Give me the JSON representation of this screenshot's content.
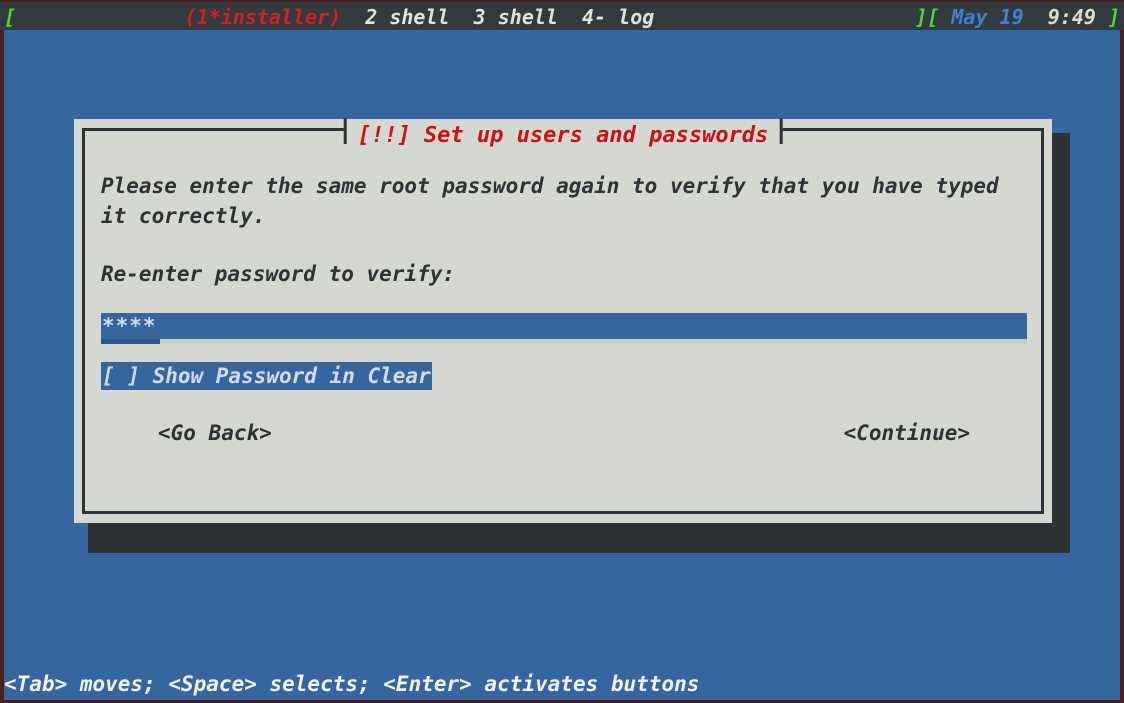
{
  "statusbar": {
    "left_bracket": "[",
    "active_window": "(1*installer)",
    "windows": [
      "2 shell",
      "3 shell",
      "4- log"
    ],
    "right_brackets": "][",
    "date": "May 19",
    "time": "9:49",
    "right_bracket": "]",
    "colors": {
      "background": "#333a3d",
      "bracket_green": "#4fd43a",
      "paren_red": "#d32020",
      "window_text": "#e2e2d8",
      "date_blue": "#3d82d6",
      "time_cream": "#ded9c8"
    }
  },
  "dialog": {
    "title": "[!!] Set up users and passwords",
    "title_color": "#cc1111",
    "background": "#d4d8d0",
    "border_color": "#2d3235",
    "paragraph": "Please enter the same root password again to verify that you have typed it correctly.",
    "field_label": "Re-enter password to verify:",
    "password_value": "****",
    "checkbox_label": "[ ] Show Password in Clear",
    "checkbox_checked": false,
    "buttons": {
      "go_back": "<Go Back>",
      "continue": "<Continue>"
    },
    "highlight_color": "#36669f"
  },
  "help_line": "<Tab> moves; <Space> selects; <Enter> activates buttons",
  "screen": {
    "background": "#36669f",
    "pane_border_color": "#4a1f22"
  }
}
